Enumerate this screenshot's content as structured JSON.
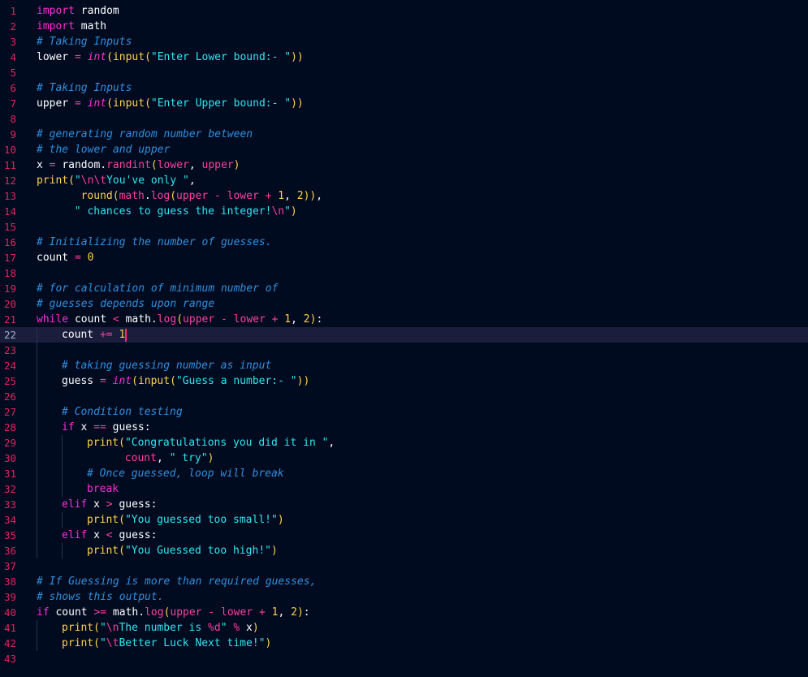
{
  "editor": {
    "language": "python",
    "current_line": 22,
    "colors": {
      "background": "#010b1f",
      "line_number": "#e0245e",
      "current_line_bg": "#1b1d3d",
      "keyword": "#ff2bd6",
      "comment": "#2f8fe0",
      "string": "#2ee6f0",
      "number": "#ffd24a"
    },
    "lines": [
      {
        "n": "1",
        "indent": 0,
        "tokens": [
          {
            "t": "import",
            "c": "kw"
          },
          {
            "t": " random",
            "c": "plain"
          }
        ]
      },
      {
        "n": "2",
        "indent": 0,
        "tokens": [
          {
            "t": "import",
            "c": "kw"
          },
          {
            "t": " math",
            "c": "plain"
          }
        ]
      },
      {
        "n": "3",
        "indent": 0,
        "tokens": [
          {
            "t": "# Taking Inputs",
            "c": "comment"
          }
        ]
      },
      {
        "n": "4",
        "indent": 0,
        "tokens": [
          {
            "t": "lower",
            "c": "plain"
          },
          {
            "t": " = ",
            "c": "op"
          },
          {
            "t": "int",
            "c": "type"
          },
          {
            "t": "(",
            "c": "paren"
          },
          {
            "t": "input",
            "c": "builtin"
          },
          {
            "t": "(",
            "c": "paren"
          },
          {
            "t": "\"Enter Lower bound:- \"",
            "c": "str"
          },
          {
            "t": "))",
            "c": "paren"
          }
        ]
      },
      {
        "n": "5",
        "indent": 0,
        "tokens": []
      },
      {
        "n": "6",
        "indent": 0,
        "tokens": [
          {
            "t": "# Taking Inputs",
            "c": "comment"
          }
        ]
      },
      {
        "n": "7",
        "indent": 0,
        "tokens": [
          {
            "t": "upper",
            "c": "plain"
          },
          {
            "t": " = ",
            "c": "op"
          },
          {
            "t": "int",
            "c": "type"
          },
          {
            "t": "(",
            "c": "paren"
          },
          {
            "t": "input",
            "c": "builtin"
          },
          {
            "t": "(",
            "c": "paren"
          },
          {
            "t": "\"Enter Upper bound:- \"",
            "c": "str"
          },
          {
            "t": "))",
            "c": "paren"
          }
        ]
      },
      {
        "n": "8",
        "indent": 0,
        "tokens": []
      },
      {
        "n": "9",
        "indent": 0,
        "tokens": [
          {
            "t": "# generating random number between",
            "c": "comment"
          }
        ]
      },
      {
        "n": "10",
        "indent": 0,
        "tokens": [
          {
            "t": "# the lower and upper",
            "c": "comment"
          }
        ]
      },
      {
        "n": "11",
        "indent": 0,
        "tokens": [
          {
            "t": "x",
            "c": "plain"
          },
          {
            "t": " = ",
            "c": "op"
          },
          {
            "t": "random",
            "c": "plain"
          },
          {
            "t": ".",
            "c": "punct"
          },
          {
            "t": "randint",
            "c": "method"
          },
          {
            "t": "(",
            "c": "paren"
          },
          {
            "t": "lower",
            "c": "param"
          },
          {
            "t": ", ",
            "c": "punct"
          },
          {
            "t": "upper",
            "c": "param"
          },
          {
            "t": ")",
            "c": "paren"
          }
        ]
      },
      {
        "n": "12",
        "indent": 0,
        "tokens": [
          {
            "t": "print",
            "c": "builtin"
          },
          {
            "t": "(",
            "c": "paren"
          },
          {
            "t": "\"",
            "c": "str"
          },
          {
            "t": "\\n\\t",
            "c": "esc"
          },
          {
            "t": "You've only \"",
            "c": "str"
          },
          {
            "t": ",",
            "c": "punct"
          }
        ]
      },
      {
        "n": "13",
        "indent": 0,
        "lead": 7,
        "tokens": [
          {
            "t": "round",
            "c": "builtin"
          },
          {
            "t": "(",
            "c": "paren"
          },
          {
            "t": "math",
            "c": "param"
          },
          {
            "t": ".",
            "c": "punct"
          },
          {
            "t": "log",
            "c": "method"
          },
          {
            "t": "(",
            "c": "paren"
          },
          {
            "t": "upper",
            "c": "param"
          },
          {
            "t": " - ",
            "c": "op"
          },
          {
            "t": "lower",
            "c": "param"
          },
          {
            "t": " + ",
            "c": "op"
          },
          {
            "t": "1",
            "c": "num"
          },
          {
            "t": ", ",
            "c": "punct"
          },
          {
            "t": "2",
            "c": "num"
          },
          {
            "t": "))",
            "c": "paren"
          },
          {
            "t": ",",
            "c": "punct"
          }
        ]
      },
      {
        "n": "14",
        "indent": 0,
        "lead": 6,
        "tokens": [
          {
            "t": "\" chances to guess the integer!",
            "c": "str"
          },
          {
            "t": "\\n",
            "c": "esc"
          },
          {
            "t": "\"",
            "c": "str"
          },
          {
            "t": ")",
            "c": "paren"
          }
        ]
      },
      {
        "n": "15",
        "indent": 0,
        "tokens": []
      },
      {
        "n": "16",
        "indent": 0,
        "tokens": [
          {
            "t": "# Initializing the number of guesses.",
            "c": "comment"
          }
        ]
      },
      {
        "n": "17",
        "indent": 0,
        "tokens": [
          {
            "t": "count",
            "c": "plain"
          },
          {
            "t": " = ",
            "c": "op"
          },
          {
            "t": "0",
            "c": "num"
          }
        ]
      },
      {
        "n": "18",
        "indent": 0,
        "tokens": []
      },
      {
        "n": "19",
        "indent": 0,
        "tokens": [
          {
            "t": "# for calculation of minimum number of",
            "c": "comment"
          }
        ]
      },
      {
        "n": "20",
        "indent": 0,
        "tokens": [
          {
            "t": "# guesses depends upon range",
            "c": "comment"
          }
        ]
      },
      {
        "n": "21",
        "indent": 0,
        "tokens": [
          {
            "t": "while",
            "c": "kw"
          },
          {
            "t": " count ",
            "c": "plain"
          },
          {
            "t": "<",
            "c": "op"
          },
          {
            "t": " math",
            "c": "plain"
          },
          {
            "t": ".",
            "c": "punct"
          },
          {
            "t": "log",
            "c": "method"
          },
          {
            "t": "(",
            "c": "paren"
          },
          {
            "t": "upper",
            "c": "param"
          },
          {
            "t": " - ",
            "c": "op"
          },
          {
            "t": "lower",
            "c": "param"
          },
          {
            "t": " + ",
            "c": "op"
          },
          {
            "t": "1",
            "c": "num"
          },
          {
            "t": ", ",
            "c": "punct"
          },
          {
            "t": "2",
            "c": "num"
          },
          {
            "t": ")",
            "c": "paren"
          },
          {
            "t": ":",
            "c": "punct"
          }
        ]
      },
      {
        "n": "22",
        "indent": 1,
        "cursor": true,
        "tokens": [
          {
            "t": "count",
            "c": "plain"
          },
          {
            "t": " += ",
            "c": "op"
          },
          {
            "t": "1",
            "c": "num"
          }
        ]
      },
      {
        "n": "23",
        "indent": 1,
        "tokens": []
      },
      {
        "n": "24",
        "indent": 1,
        "tokens": [
          {
            "t": "# taking guessing number as input",
            "c": "comment"
          }
        ]
      },
      {
        "n": "25",
        "indent": 1,
        "tokens": [
          {
            "t": "guess",
            "c": "plain"
          },
          {
            "t": " = ",
            "c": "op"
          },
          {
            "t": "int",
            "c": "type"
          },
          {
            "t": "(",
            "c": "paren"
          },
          {
            "t": "input",
            "c": "builtin"
          },
          {
            "t": "(",
            "c": "paren"
          },
          {
            "t": "\"Guess a number:- \"",
            "c": "str"
          },
          {
            "t": "))",
            "c": "paren"
          }
        ]
      },
      {
        "n": "26",
        "indent": 1,
        "tokens": []
      },
      {
        "n": "27",
        "indent": 1,
        "tokens": [
          {
            "t": "# Condition testing",
            "c": "comment"
          }
        ]
      },
      {
        "n": "28",
        "indent": 1,
        "tokens": [
          {
            "t": "if",
            "c": "kw"
          },
          {
            "t": " x ",
            "c": "plain"
          },
          {
            "t": "==",
            "c": "op"
          },
          {
            "t": " guess",
            "c": "plain"
          },
          {
            "t": ":",
            "c": "punct"
          }
        ]
      },
      {
        "n": "29",
        "indent": 2,
        "tokens": [
          {
            "t": "print",
            "c": "builtin"
          },
          {
            "t": "(",
            "c": "paren"
          },
          {
            "t": "\"Congratulations you did it in \"",
            "c": "str"
          },
          {
            "t": ",",
            "c": "punct"
          }
        ]
      },
      {
        "n": "30",
        "indent": 2,
        "lead": 6,
        "tokens": [
          {
            "t": "count",
            "c": "param"
          },
          {
            "t": ", ",
            "c": "punct"
          },
          {
            "t": "\" try\"",
            "c": "str"
          },
          {
            "t": ")",
            "c": "paren"
          }
        ]
      },
      {
        "n": "31",
        "indent": 2,
        "tokens": [
          {
            "t": "# Once guessed, loop will break",
            "c": "comment"
          }
        ]
      },
      {
        "n": "32",
        "indent": 2,
        "tokens": [
          {
            "t": "break",
            "c": "kw"
          }
        ]
      },
      {
        "n": "33",
        "indent": 1,
        "tokens": [
          {
            "t": "elif",
            "c": "kw"
          },
          {
            "t": " x ",
            "c": "plain"
          },
          {
            "t": ">",
            "c": "op"
          },
          {
            "t": " guess",
            "c": "plain"
          },
          {
            "t": ":",
            "c": "punct"
          }
        ]
      },
      {
        "n": "34",
        "indent": 2,
        "tokens": [
          {
            "t": "print",
            "c": "builtin"
          },
          {
            "t": "(",
            "c": "paren"
          },
          {
            "t": "\"You guessed too small!\"",
            "c": "str"
          },
          {
            "t": ")",
            "c": "paren"
          }
        ]
      },
      {
        "n": "35",
        "indent": 1,
        "tokens": [
          {
            "t": "elif",
            "c": "kw"
          },
          {
            "t": " x ",
            "c": "plain"
          },
          {
            "t": "<",
            "c": "op"
          },
          {
            "t": " guess",
            "c": "plain"
          },
          {
            "t": ":",
            "c": "punct"
          }
        ]
      },
      {
        "n": "36",
        "indent": 2,
        "tokens": [
          {
            "t": "print",
            "c": "builtin"
          },
          {
            "t": "(",
            "c": "paren"
          },
          {
            "t": "\"You Guessed too high!\"",
            "c": "str"
          },
          {
            "t": ")",
            "c": "paren"
          }
        ]
      },
      {
        "n": "37",
        "indent": 0,
        "tokens": []
      },
      {
        "n": "38",
        "indent": 0,
        "tokens": [
          {
            "t": "# If Guessing is more than required guesses,",
            "c": "comment"
          }
        ]
      },
      {
        "n": "39",
        "indent": 0,
        "tokens": [
          {
            "t": "# shows this output.",
            "c": "comment"
          }
        ]
      },
      {
        "n": "40",
        "indent": 0,
        "tokens": [
          {
            "t": "if",
            "c": "kw"
          },
          {
            "t": " count ",
            "c": "plain"
          },
          {
            "t": ">=",
            "c": "op"
          },
          {
            "t": " math",
            "c": "plain"
          },
          {
            "t": ".",
            "c": "punct"
          },
          {
            "t": "log",
            "c": "method"
          },
          {
            "t": "(",
            "c": "paren"
          },
          {
            "t": "upper",
            "c": "param"
          },
          {
            "t": " - ",
            "c": "op"
          },
          {
            "t": "lower",
            "c": "param"
          },
          {
            "t": " + ",
            "c": "op"
          },
          {
            "t": "1",
            "c": "num"
          },
          {
            "t": ", ",
            "c": "punct"
          },
          {
            "t": "2",
            "c": "num"
          },
          {
            "t": ")",
            "c": "paren"
          },
          {
            "t": ":",
            "c": "punct"
          }
        ]
      },
      {
        "n": "41",
        "indent": 1,
        "tokens": [
          {
            "t": "print",
            "c": "builtin"
          },
          {
            "t": "(",
            "c": "paren"
          },
          {
            "t": "\"",
            "c": "str"
          },
          {
            "t": "\\n",
            "c": "esc"
          },
          {
            "t": "The number is ",
            "c": "str"
          },
          {
            "t": "%d",
            "c": "esc"
          },
          {
            "t": "\"",
            "c": "str"
          },
          {
            "t": " % ",
            "c": "op"
          },
          {
            "t": "x",
            "c": "plain"
          },
          {
            "t": ")",
            "c": "paren"
          }
        ]
      },
      {
        "n": "42",
        "indent": 1,
        "tokens": [
          {
            "t": "print",
            "c": "builtin"
          },
          {
            "t": "(",
            "c": "paren"
          },
          {
            "t": "\"",
            "c": "str"
          },
          {
            "t": "\\t",
            "c": "esc"
          },
          {
            "t": "Better Luck Next time!\"",
            "c": "str"
          },
          {
            "t": ")",
            "c": "paren"
          }
        ]
      },
      {
        "n": "43",
        "indent": 0,
        "tokens": []
      }
    ]
  }
}
